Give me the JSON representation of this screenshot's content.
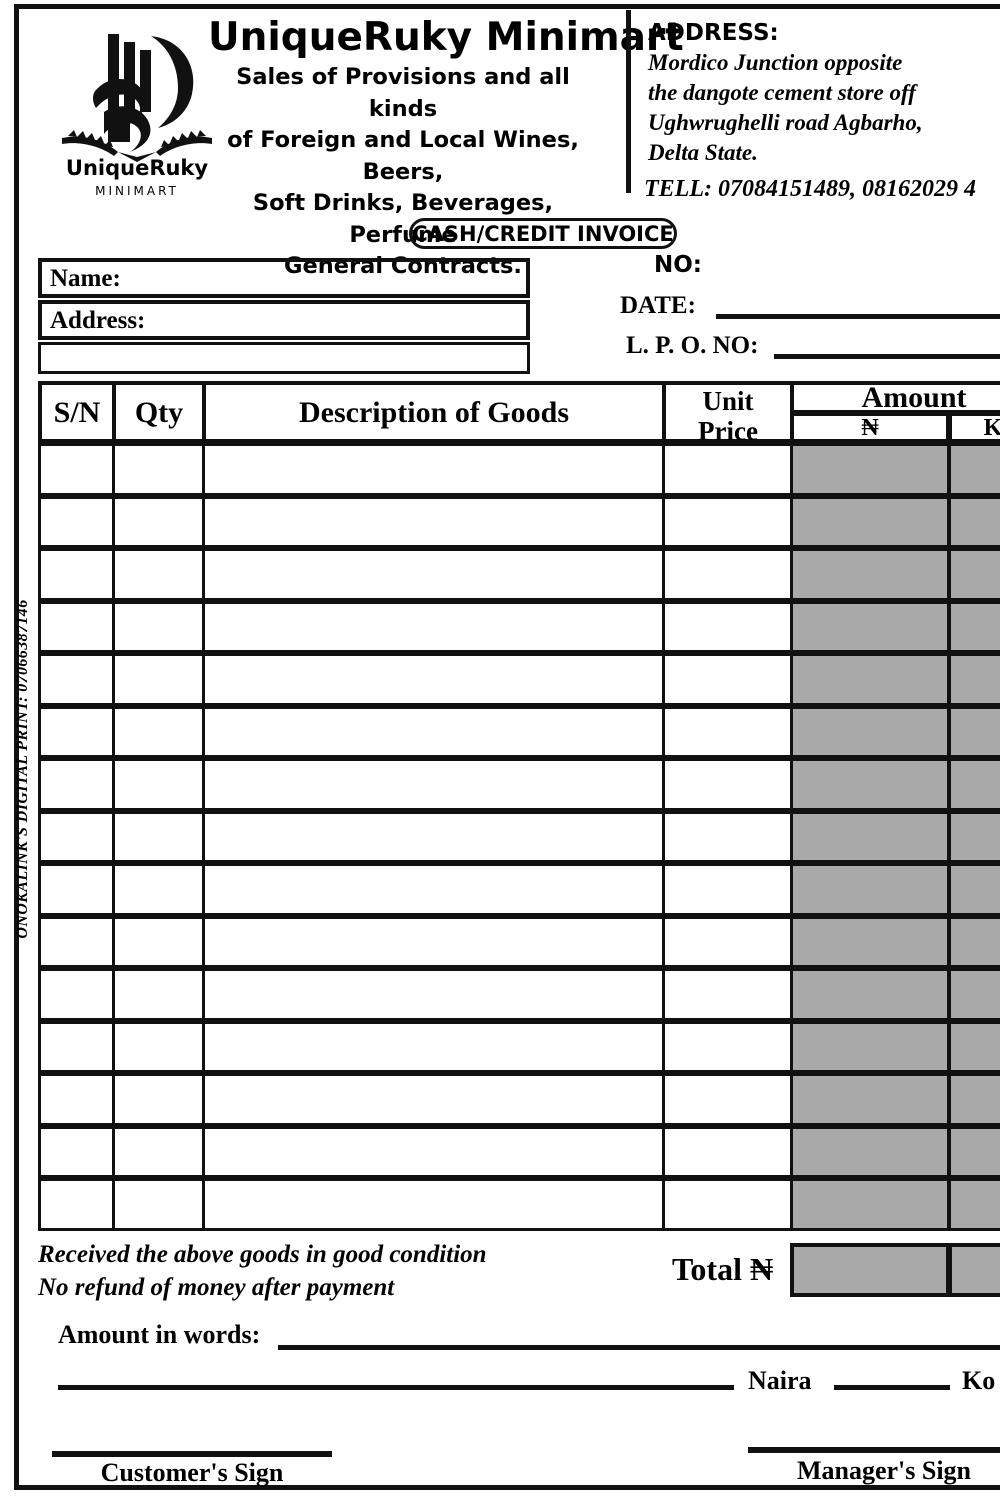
{
  "company": {
    "logo_wordmark": "UniqueRuky",
    "logo_subtext": "MINIMART",
    "title": "UniqueRuky Minimart",
    "tagline_lines": [
      "Sales of Provisions and all kinds",
      "of Foreign and Local Wines, Beers,",
      "Soft Drinks, Beverages, Perfume",
      "General Contracts."
    ]
  },
  "address": {
    "label": "ADDRESS:",
    "lines": [
      "Mordico Junction opposite",
      "the dangote cement store off",
      "Ughwrughelli road Agbarho,",
      "Delta State."
    ],
    "tell": "TELL: 07084151489, 08162029 4"
  },
  "invoice_badge": "CASH/CREDIT INVOICE",
  "customer": {
    "name_label": "Name:",
    "address_label": "Address:",
    "address_continuation": ""
  },
  "meta": {
    "no_label": "NO:",
    "date_label": "DATE:",
    "lpo_label": "L. P. O. NO:"
  },
  "table": {
    "headers": {
      "sn": "S/N",
      "qty": "Qty",
      "description": "Description of Goods",
      "unit_price_line1": "Unit",
      "unit_price_line2": "Price",
      "amount": "Amount",
      "amount_naira": "₦",
      "amount_kobo": "K"
    },
    "row_count": 15,
    "rows": [
      {
        "sn": "",
        "qty": "",
        "description": "",
        "unit_price": "",
        "naira": "",
        "kobo": ""
      },
      {
        "sn": "",
        "qty": "",
        "description": "",
        "unit_price": "",
        "naira": "",
        "kobo": ""
      },
      {
        "sn": "",
        "qty": "",
        "description": "",
        "unit_price": "",
        "naira": "",
        "kobo": ""
      },
      {
        "sn": "",
        "qty": "",
        "description": "",
        "unit_price": "",
        "naira": "",
        "kobo": ""
      },
      {
        "sn": "",
        "qty": "",
        "description": "",
        "unit_price": "",
        "naira": "",
        "kobo": ""
      },
      {
        "sn": "",
        "qty": "",
        "description": "",
        "unit_price": "",
        "naira": "",
        "kobo": ""
      },
      {
        "sn": "",
        "qty": "",
        "description": "",
        "unit_price": "",
        "naira": "",
        "kobo": ""
      },
      {
        "sn": "",
        "qty": "",
        "description": "",
        "unit_price": "",
        "naira": "",
        "kobo": ""
      },
      {
        "sn": "",
        "qty": "",
        "description": "",
        "unit_price": "",
        "naira": "",
        "kobo": ""
      },
      {
        "sn": "",
        "qty": "",
        "description": "",
        "unit_price": "",
        "naira": "",
        "kobo": ""
      },
      {
        "sn": "",
        "qty": "",
        "description": "",
        "unit_price": "",
        "naira": "",
        "kobo": ""
      },
      {
        "sn": "",
        "qty": "",
        "description": "",
        "unit_price": "",
        "naira": "",
        "kobo": ""
      },
      {
        "sn": "",
        "qty": "",
        "description": "",
        "unit_price": "",
        "naira": "",
        "kobo": ""
      },
      {
        "sn": "",
        "qty": "",
        "description": "",
        "unit_price": "",
        "naira": "",
        "kobo": ""
      },
      {
        "sn": "",
        "qty": "",
        "description": "",
        "unit_price": "",
        "naira": "",
        "kobo": ""
      }
    ]
  },
  "totals": {
    "label": "Total ₦",
    "naira_value": "",
    "kobo_value": ""
  },
  "disclaimer": {
    "line1": "Received the above goods in good condition",
    "line2": "No refund of money after payment"
  },
  "footer": {
    "amount_in_words_label": "Amount in words:",
    "naira_label": "Naira",
    "kobo_label": "Ko",
    "customer_sign": "Customer's Sign",
    "manager_sign": "Manager's Sign"
  },
  "printer_credit": "ONOKALINK'S DIGITAL PRINT: 07066387146",
  "colors": {
    "ink": "#111111",
    "amount_fill": "#a9a9a9",
    "paper": "#ffffff"
  }
}
